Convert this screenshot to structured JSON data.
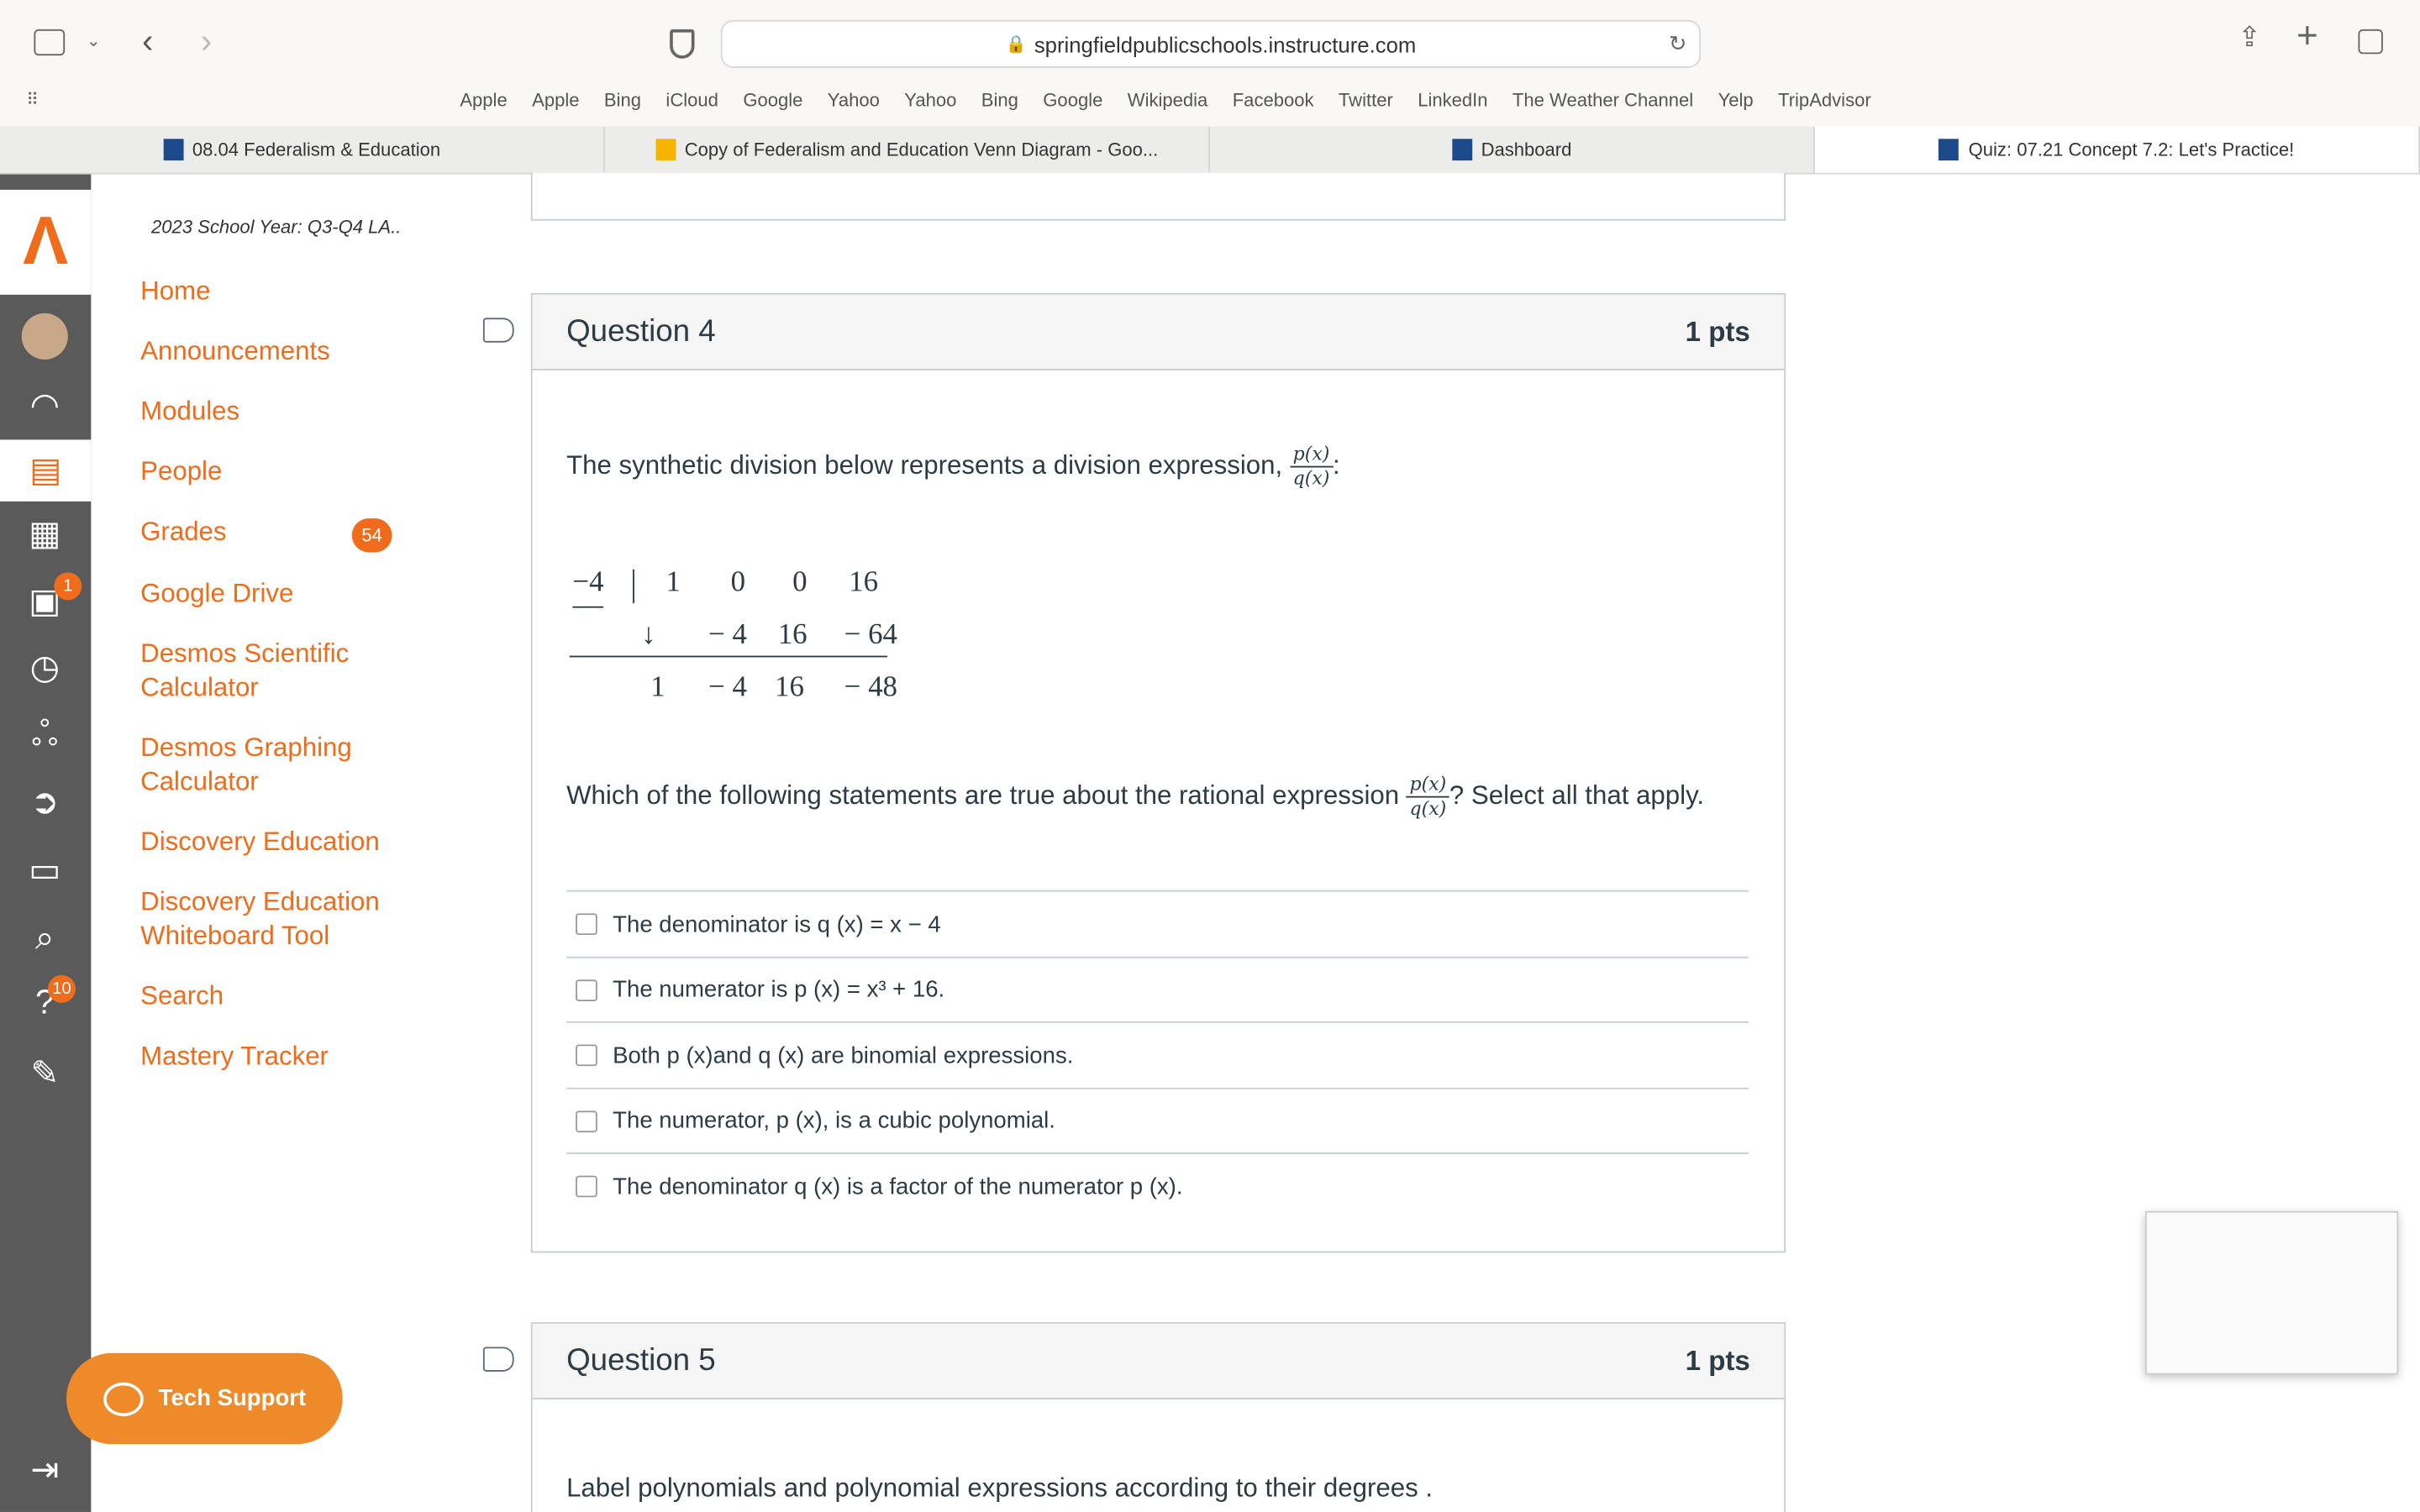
{
  "browser": {
    "url": "springfieldpublicschools.instructure.com",
    "favorites": [
      "Apple",
      "Apple",
      "Bing",
      "iCloud",
      "Google",
      "Yahoo",
      "Yahoo",
      "Bing",
      "Google",
      "Wikipedia",
      "Facebook",
      "Twitter",
      "LinkedIn",
      "The Weather Channel",
      "Yelp",
      "TripAdvisor"
    ],
    "tabs": [
      {
        "label": "08.04 Federalism & Education"
      },
      {
        "label": "Copy of Federalism and Education Venn Diagram - Goo..."
      },
      {
        "label": "Dashboard"
      },
      {
        "label": "Quiz: 07.21 Concept 7.2: Let's Practice!"
      }
    ]
  },
  "course": {
    "title": "2023 School Year: Q3-Q4 LA..",
    "nav": [
      {
        "label": "Home"
      },
      {
        "label": "Announcements"
      },
      {
        "label": "Modules"
      },
      {
        "label": "People"
      },
      {
        "label": "Grades",
        "badge": "54"
      },
      {
        "label": "Google Drive"
      },
      {
        "label": "Desmos Scientific Calculator"
      },
      {
        "label": "Desmos Graphing Calculator"
      },
      {
        "label": "Discovery Education"
      },
      {
        "label": "Discovery Education Whiteboard Tool"
      },
      {
        "label": "Search"
      },
      {
        "label": "Mastery Tracker"
      }
    ]
  },
  "rail": {
    "inbox_badge": "1",
    "help_badge": "10"
  },
  "tech_support": "Tech Support",
  "q4": {
    "title": "Question 4",
    "pts": "1 pts",
    "intro": "The synthetic division below represents a division expression,",
    "intro_end": ":",
    "frac_num": "p(x)",
    "frac_den": "q(x)",
    "division": {
      "divisor": "−4",
      "row1": [
        "1",
        "0",
        "0",
        "16"
      ],
      "row2": [
        "↓",
        "− 4",
        "16",
        "− 64"
      ],
      "row3": [
        "1",
        "− 4",
        "16",
        "− 48"
      ]
    },
    "prompt": "Which of the following statements are true about the rational expression",
    "prompt_end": "? Select all that apply.",
    "answers": [
      {
        "label": "The denominator is q (x) = x − 4"
      },
      {
        "label": "The numerator is p (x) = x³ + 16."
      },
      {
        "label": "Both p (x)and q (x) are binomial expressions."
      },
      {
        "label": "The numerator, p (x), is a cubic polynomial."
      },
      {
        "label": "The denominator q (x) is a factor of the numerator p (x)."
      }
    ]
  },
  "q5": {
    "title": "Question 5",
    "pts": "1 pts",
    "text": "Label polynomials and polynomial expressions according to their degrees ."
  }
}
